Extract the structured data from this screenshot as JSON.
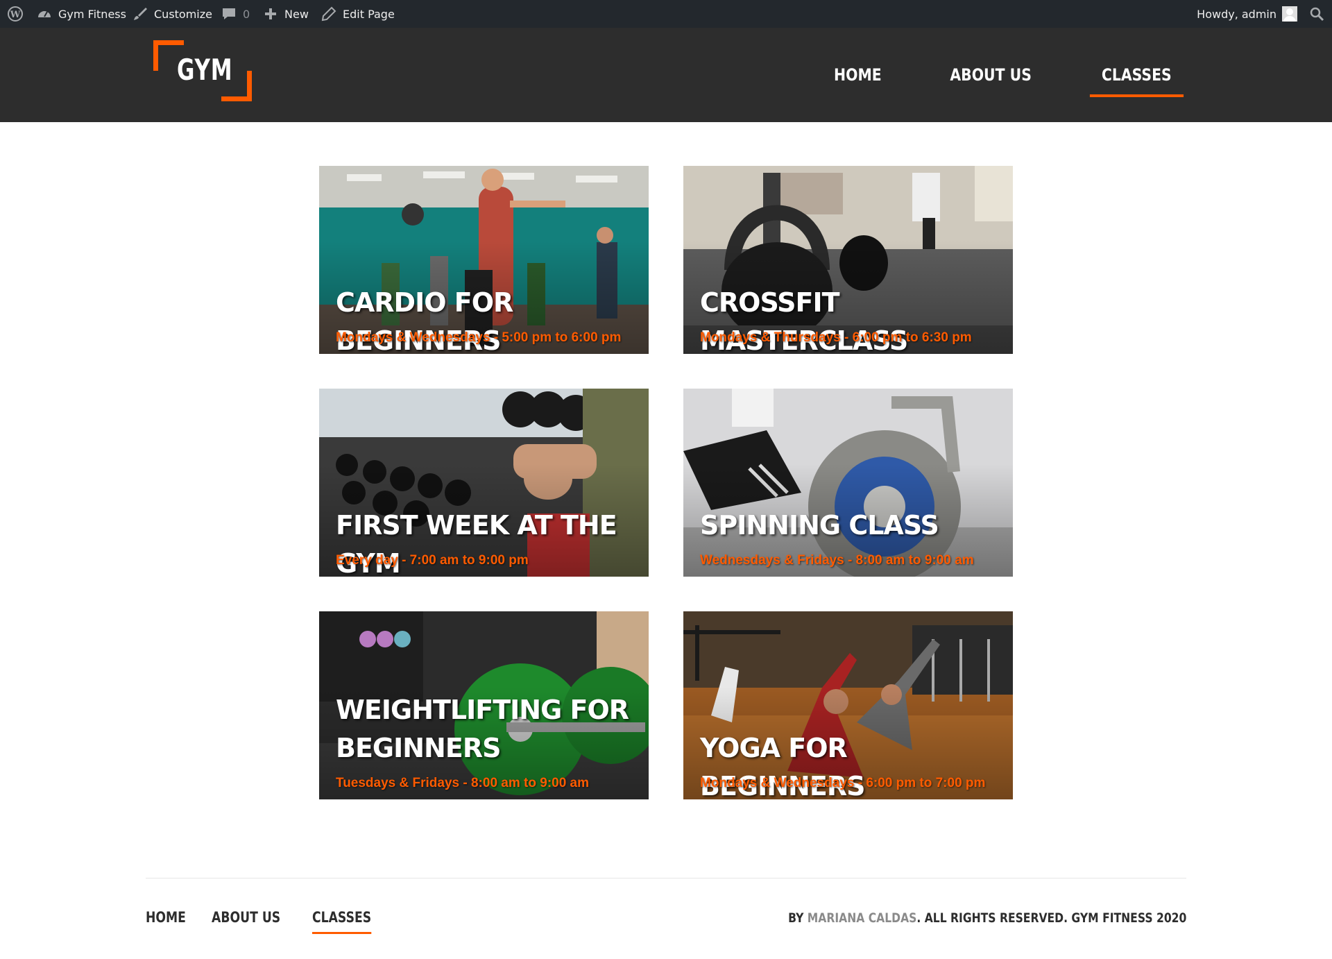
{
  "adminbar": {
    "wp_icon": "wordpress-icon",
    "site_name": "Gym Fitness",
    "customize": "Customize",
    "comments_count": "0",
    "new": "New",
    "edit_page": "Edit Page",
    "howdy": "Howdy, admin"
  },
  "header": {
    "logo_text": "GYM",
    "nav": [
      "HOME",
      "ABOUT US",
      "CLASSES"
    ],
    "active_nav": "CLASSES"
  },
  "classes": [
    {
      "title": "CARDIO FOR BEGINNERS",
      "schedule": "Mondays & Wednesdays - 5:00 pm to 6:00 pm",
      "image": "cardio-class-photo"
    },
    {
      "title": "CROSSFIT MASTERCLASS",
      "schedule": "Mondays & Thursdays - 6:00 pm to 6:30 pm",
      "image": "kettlebell-photo"
    },
    {
      "title": "FIRST WEEK AT THE GYM",
      "schedule": "Every day - 7:00 am to 9:00 pm",
      "image": "dumbbell-rack-photo"
    },
    {
      "title": "SPINNING CLASS",
      "schedule": "Wednesdays & Fridays - 8:00 am to 9:00 am",
      "image": "spinning-bike-photo"
    },
    {
      "title_line1": "WEIGHTLIFTING FOR",
      "title_line2": "BEGINNERS",
      "schedule": "Tuesdays & Fridays - 8:00 am to 9:00 am",
      "image": "weight-plates-photo"
    },
    {
      "title": "YOGA FOR BEGINNERS",
      "schedule": "Mondays & Wednesdays - 6:00 pm to 7:00 pm",
      "image": "yoga-class-photo"
    }
  ],
  "footer": {
    "nav": [
      "HOME",
      "ABOUT US",
      "CLASSES"
    ],
    "active_nav": "CLASSES",
    "credits_prefix": "BY",
    "author": "MARIANA CALDAS",
    "credits_suffix": ". ALL RIGHTS RESERVED. GYM FITNESS 2020"
  },
  "colors": {
    "accent": "#ff5b00",
    "header_bg": "#2d2d2d",
    "adminbar_bg": "#23282d"
  }
}
